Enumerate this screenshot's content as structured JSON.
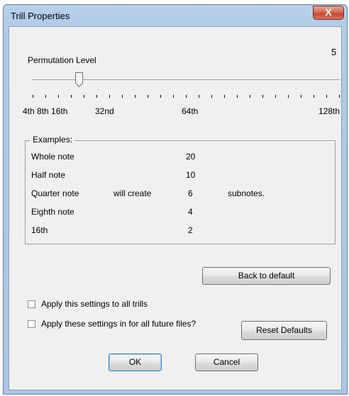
{
  "window": {
    "title": "Trill Properties",
    "close_label": "X"
  },
  "slider": {
    "label": "Permutation Level",
    "value_text": "5",
    "tick_labels": [
      "4th 8th 16th",
      "32nd",
      "64th",
      "128th"
    ]
  },
  "examples": {
    "title": "Examples:",
    "rows": [
      {
        "note": "Whole note",
        "count": "20"
      },
      {
        "note": "Half note",
        "count": "10"
      },
      {
        "note": "Quarter note",
        "mid": "will create",
        "count": "6",
        "suffix": "subnotes."
      },
      {
        "note": "Eighth note",
        "count": "4"
      },
      {
        "note": "16th",
        "count": "2"
      }
    ]
  },
  "buttons": {
    "back_to_default": "Back to default",
    "reset_defaults": "Reset Defaults",
    "ok": "OK",
    "cancel": "Cancel"
  },
  "checkboxes": {
    "apply_all_trills": "Apply this settings to all trills",
    "apply_future_files": "Apply these settings in for all future files?"
  }
}
